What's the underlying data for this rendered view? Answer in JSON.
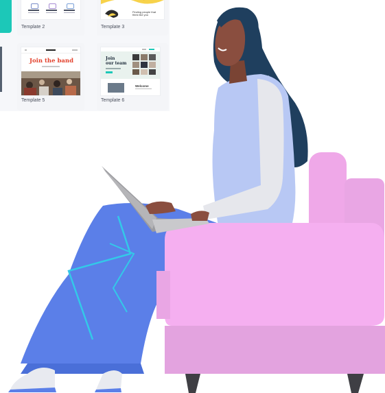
{
  "gallery": {
    "templates": [
      {
        "label": "Template 2"
      },
      {
        "label": "Template 3"
      },
      {
        "label": "Template 5",
        "thumb_title": "Join the band"
      },
      {
        "label": "Template 6",
        "thumb_title_line1": "Join",
        "thumb_title_line2": "our team",
        "thumb_footer": "Welcome"
      }
    ],
    "template3_caption": "Finding people that think like you"
  },
  "colors": {
    "teal": "#1cc8b8",
    "chair_pink": "#f3a6ec",
    "pants_blue": "#5b7fe8",
    "top_lavender": "#b4c6f6",
    "hair": "#1f3f5e",
    "skin": "#8a4e3f",
    "laptop_gray": "#a3a3a6"
  }
}
